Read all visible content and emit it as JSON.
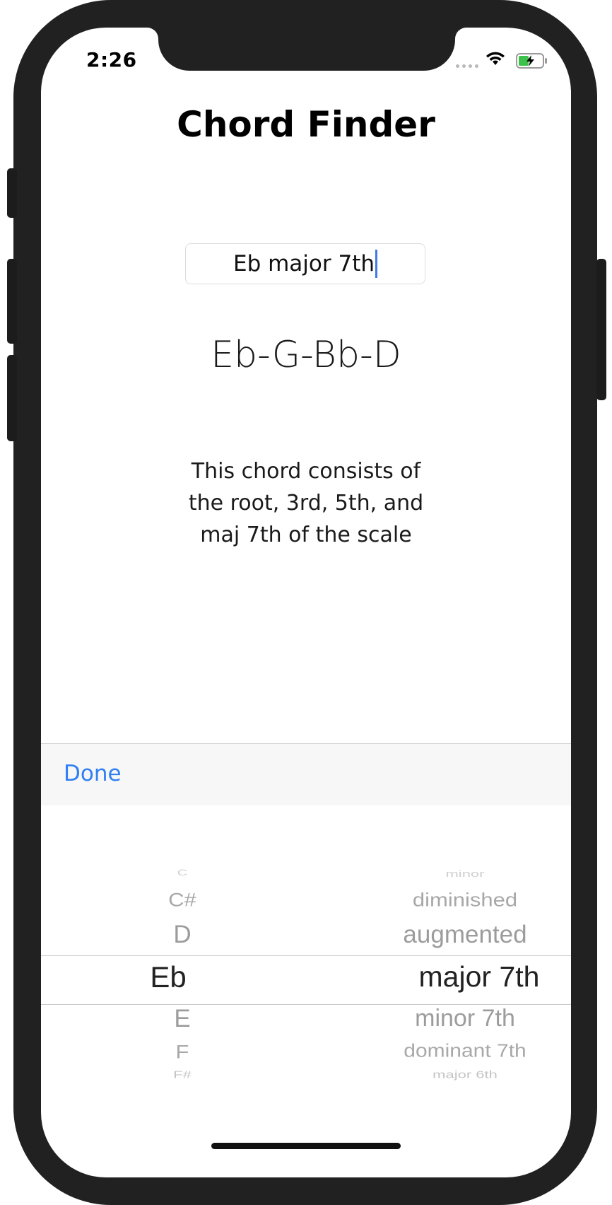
{
  "status_bar": {
    "time": "2:26"
  },
  "app": {
    "title": "Chord Finder"
  },
  "chord_input": {
    "value": "Eb major 7th"
  },
  "result": {
    "notes": "Eb-G-Bb-D",
    "description": "This chord consists of the root, 3rd, 5th, and maj 7th of the scale"
  },
  "toolbar": {
    "done_label": "Done"
  },
  "picker": {
    "roots": [
      "C",
      "C#",
      "D",
      "Eb",
      "E",
      "F",
      "F#"
    ],
    "qualities": [
      "minor",
      "diminished",
      "augmented",
      "major 7th",
      "minor 7th",
      "dominant 7th",
      "major 6th"
    ],
    "selected_root": "Eb",
    "selected_quality": "major 7th"
  },
  "colors": {
    "accent": "#2f7ff5",
    "caret": "#3d7be8",
    "frame": "#212121"
  }
}
